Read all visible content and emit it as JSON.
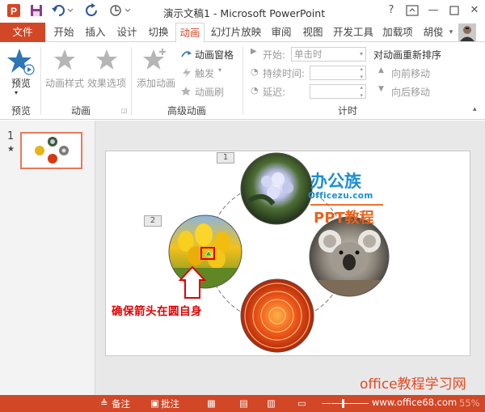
{
  "titlebar": {
    "title": "演示文稿1 - Microsoft PowerPoint",
    "icons": [
      "powerpoint-icon",
      "save-icon",
      "undo-icon",
      "redo-icon",
      "presenter-icon"
    ],
    "window_controls": [
      "help",
      "ribbon-display",
      "minimize",
      "maximize",
      "close"
    ]
  },
  "tabs": {
    "file": "文件",
    "items": [
      "开始",
      "插入",
      "设计",
      "切换",
      "动画",
      "幻灯片放映",
      "审阅",
      "视图",
      "开发工具",
      "加载项"
    ],
    "active": "动画",
    "user": "胡俊"
  },
  "ribbon": {
    "preview_group": {
      "label": "预览",
      "button": "预览"
    },
    "animation_group": {
      "label": "动画",
      "style_button": "动画样式",
      "options_button": "效果选项"
    },
    "advanced_group": {
      "label": "高级动画",
      "add_button": "添加动画",
      "pane_button": "动画窗格",
      "trigger_button": "触发",
      "painter_button": "动画刷"
    },
    "timing_group": {
      "label": "计时",
      "start_label": "开始:",
      "start_value": "单击时",
      "duration_label": "持续时间:",
      "delay_label": "延迟:",
      "reorder_title": "对动画重新排序",
      "move_earlier": "向前移动",
      "move_later": "向后移动"
    }
  },
  "slides_pane": {
    "slide_number": "1",
    "animation_marker": "★"
  },
  "slide": {
    "tags": [
      "1",
      "2"
    ],
    "note": "确保箭头在圆自身",
    "watermark": {
      "logo": "办公族",
      "site": "Officezu.com",
      "caption": "PPT教程"
    }
  },
  "bottom_watermark": "office教程学习网",
  "statusbar": {
    "notes": "备注",
    "comments": "批注",
    "zoom": "55%",
    "url": "www.office68.com"
  },
  "colors": {
    "accent": "#d24726",
    "note_red": "#e00000",
    "star_blue": "#2e75b6"
  }
}
